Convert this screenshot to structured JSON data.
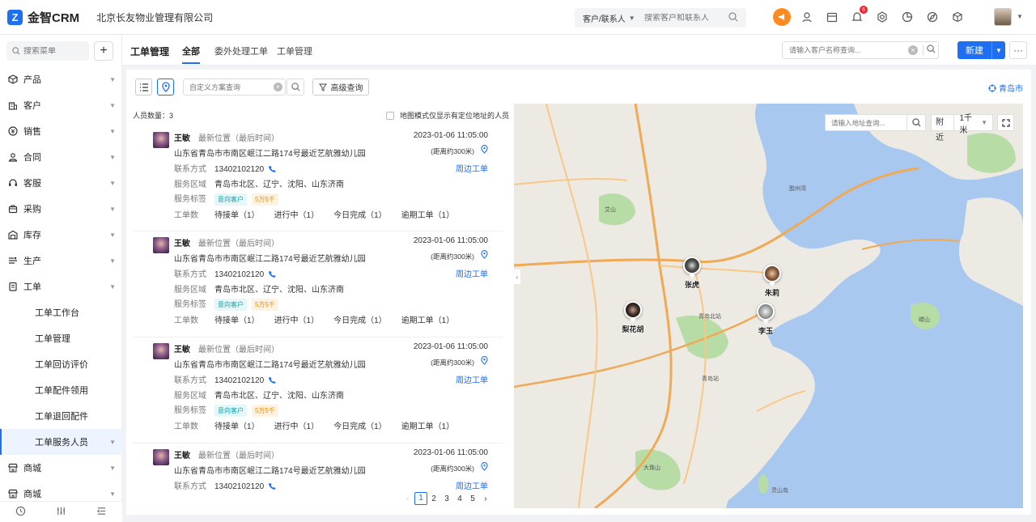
{
  "app": {
    "name": "金智CRM",
    "logo_letter": "Z",
    "company": "北京长友物业管理有限公司"
  },
  "topbar": {
    "search_type": "客户/联系人",
    "search_placeholder": "搜索客户和联系人",
    "icons": [
      "megaphone-icon",
      "contacts-icon",
      "calendar-icon",
      "bell-icon",
      "settings-icon",
      "chart-icon",
      "explore-icon",
      "box-icon"
    ],
    "notification_count": "6"
  },
  "sidebar": {
    "search_placeholder": "搜索菜单",
    "menu": [
      {
        "label": "产品",
        "icon": "cube-icon"
      },
      {
        "label": "客户",
        "icon": "building-icon"
      },
      {
        "label": "销售",
        "icon": "sales-icon"
      },
      {
        "label": "合同",
        "icon": "contract-icon"
      },
      {
        "label": "客服",
        "icon": "headset-icon"
      },
      {
        "label": "采购",
        "icon": "purchase-icon"
      },
      {
        "label": "库存",
        "icon": "warehouse-icon"
      },
      {
        "label": "生产",
        "icon": "production-icon"
      },
      {
        "label": "工单",
        "icon": "ticket-icon"
      }
    ],
    "submenu": [
      "工单工作台",
      "工单管理",
      "工单回访评价",
      "工单配件领用",
      "工单退回配件",
      "工单服务人员"
    ],
    "menu_after": [
      {
        "label": "商城",
        "icon": "shop-icon"
      },
      {
        "label": "商城",
        "icon": "shop-icon"
      }
    ]
  },
  "tabs": {
    "title": "工单管理",
    "items": [
      "全部",
      "委外处理工单",
      "工单管理"
    ],
    "active_index": 0,
    "customer_search_placeholder": "请输入客户名称查询...",
    "new_label": "新建"
  },
  "toolbar": {
    "scheme_placeholder": "自定义方案查询",
    "advanced_label": "高级查询",
    "city": "青岛市"
  },
  "list": {
    "count_label": "人员数量：3",
    "only_map_label": "地图模式仅显示有定位地址的人员",
    "field_labels": {
      "latest": "最新位置（最后时间）",
      "contact": "联系方式",
      "area": "服务区域",
      "tags": "服务标签",
      "orders": "工单数",
      "nearby": "周边工单"
    },
    "people": [
      {
        "name": "王敏",
        "time": "2023-01-06 11:05:00",
        "address": "山东省青岛市市南区岷江二路174号最近艺航雅幼儿园",
        "distance": "(距离约300米)",
        "phone": "13402102120",
        "area": "青岛市北区、辽宁、沈阳、山东济南",
        "tags": [
          "意向客户",
          "5万5千"
        ],
        "counts": [
          "待接单（1）",
          "进行中（1）",
          "今日完成（1）",
          "逾期工单（1）"
        ]
      },
      {
        "name": "王敏",
        "time": "2023-01-06 11:05:00",
        "address": "山东省青岛市市南区岷江二路174号最近艺航雅幼儿园",
        "distance": "(距离约300米)",
        "phone": "13402102120",
        "area": "青岛市北区、辽宁、沈阳、山东济南",
        "tags": [
          "意向客户",
          "5万5千"
        ],
        "counts": [
          "待接单（1）",
          "进行中（1）",
          "今日完成（1）",
          "逾期工单（1）"
        ]
      },
      {
        "name": "王敏",
        "time": "2023-01-06 11:05:00",
        "address": "山东省青岛市市南区岷江二路174号最近艺航雅幼儿园",
        "distance": "(距离约300米)",
        "phone": "13402102120",
        "area": "青岛市北区、辽宁、沈阳、山东济南",
        "tags": [
          "意向客户",
          "5万5千"
        ],
        "counts": [
          "待接单（1）",
          "进行中（1）",
          "今日完成（1）",
          "逾期工单（1）"
        ]
      },
      {
        "name": "王敏",
        "time": "2023-01-06 11:05:00",
        "address": "山东省青岛市市南区岷江二路174号最近艺航雅幼儿园",
        "distance": "(距离约300米)",
        "phone": "13402102120"
      }
    ],
    "pager": {
      "pages": [
        "1",
        "2",
        "3",
        "4",
        "5"
      ],
      "current": "1"
    }
  },
  "map": {
    "search_placeholder": "请输入地址查询...",
    "nearby_label": "附近",
    "radius": "1千米",
    "markers": [
      "张虎",
      "朱莉",
      "梨花胡",
      "李玉"
    ],
    "place_labels": [
      "艾山",
      "青岛北站",
      "青岛站",
      "崂山",
      "胶州湾",
      "大珠山",
      "灵山岛"
    ]
  },
  "colors": {
    "primary": "#1f6ff2",
    "accent": "#ff8b1f",
    "tag_cyan": "#14a0b0",
    "tag_orange": "#e88d18"
  }
}
